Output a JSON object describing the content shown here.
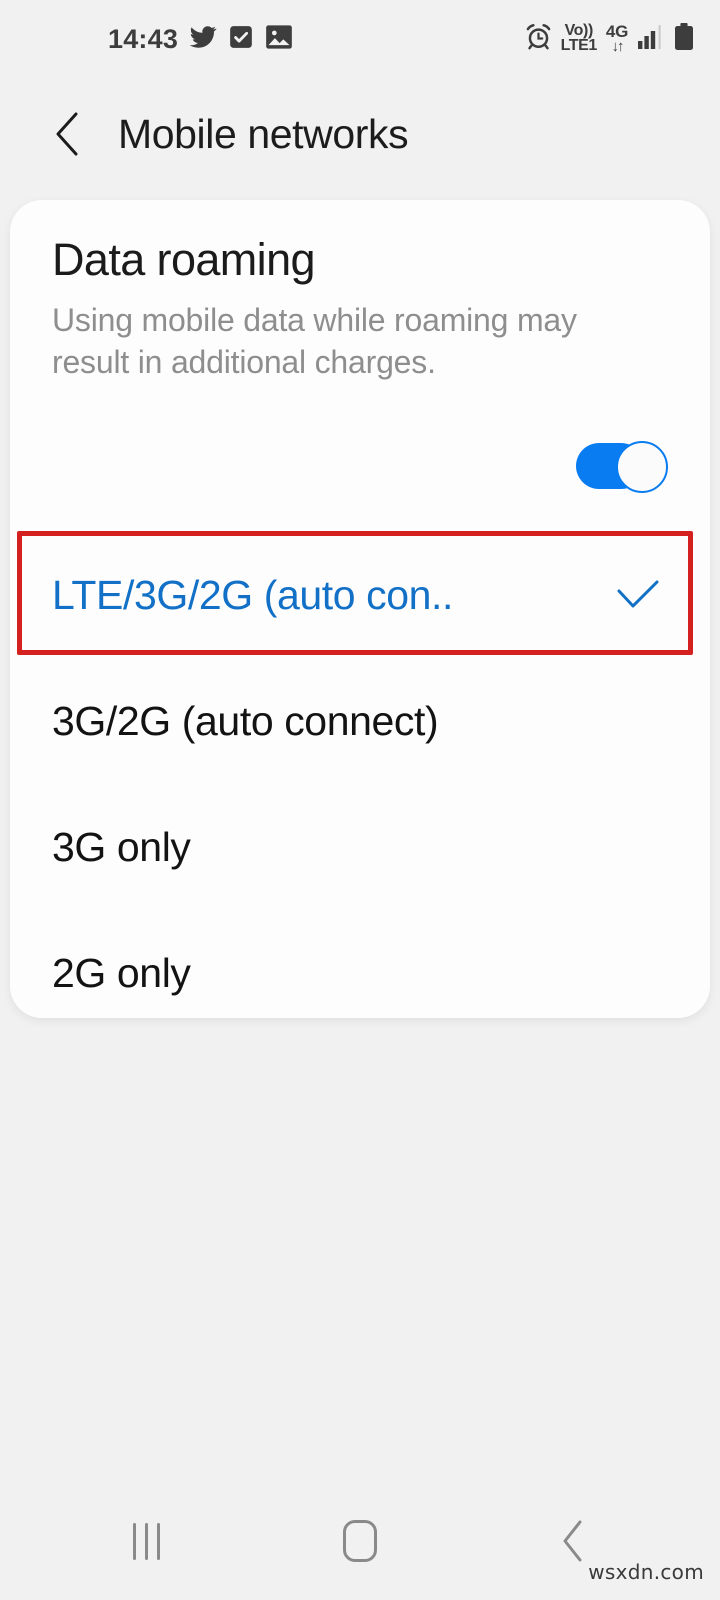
{
  "status_bar": {
    "clock": "14:43",
    "left_icons": [
      {
        "name": "twitter-icon",
        "label": "Twitter"
      },
      {
        "name": "task-checkbox-icon",
        "label": "Tasks"
      },
      {
        "name": "gallery-image-icon",
        "label": "Gallery"
      }
    ],
    "right_icons": [
      {
        "name": "alarm-clock-icon",
        "label": "Alarm"
      },
      {
        "name": "volte-icon",
        "line1": "Vo))",
        "line2": "LTE1"
      },
      {
        "name": "mobile-data-icon",
        "network": "4G",
        "arrows": "↓↑"
      },
      {
        "name": "signal-bars-icon",
        "label": "Signal",
        "bars_filled": 3,
        "bars_total": 4
      },
      {
        "name": "battery-icon",
        "label": "Battery"
      }
    ]
  },
  "header": {
    "back_label": "Back",
    "title": "Mobile networks"
  },
  "roaming": {
    "title": "Data roaming",
    "description": "Using mobile data while roaming may result in additional charges.",
    "toggle_state": "on",
    "toggle_color": "#0a7cf1"
  },
  "network_mode": {
    "selected": "LTE/3G/2G (auto con..",
    "selected_color": "#1271c7",
    "options": [
      {
        "label": "LTE/3G/2G (auto con..",
        "selected": true
      },
      {
        "label": "3G/2G (auto connect)",
        "selected": false
      },
      {
        "label": "3G only",
        "selected": false
      },
      {
        "label": "2G only",
        "selected": false
      }
    ]
  },
  "annotation": {
    "color": "#d52020",
    "target": "LTE/3G/2G (auto con.."
  },
  "nav_bar": {
    "recents_label": "Recents",
    "home_label": "Home",
    "back_label": "Back"
  },
  "watermark": {
    "text": "wsxdn.com"
  }
}
